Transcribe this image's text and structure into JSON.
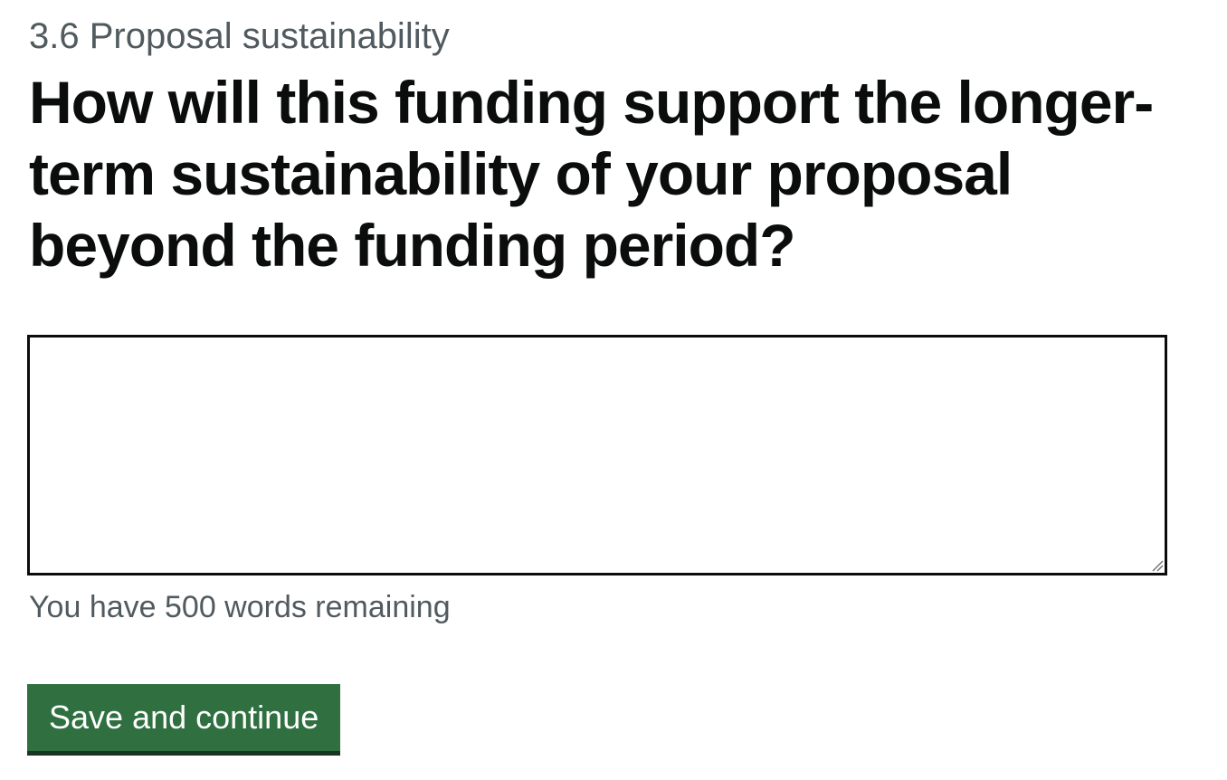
{
  "form": {
    "caption": "3.6 Proposal sustainability",
    "question": "How will this funding support the longer-term sustainability of your proposal beyond the funding period?",
    "answer_value": "",
    "word_count_hint": "You have 500 words remaining",
    "submit_label": "Save and continue"
  },
  "icons": {
    "resize_handle": "resize-grip-icon"
  },
  "colors": {
    "text": "#0b0c0c",
    "secondary_text": "#505a5f",
    "button_background": "#2f6f40",
    "button_shadow": "#173520",
    "input_border": "#0b0c0c"
  }
}
